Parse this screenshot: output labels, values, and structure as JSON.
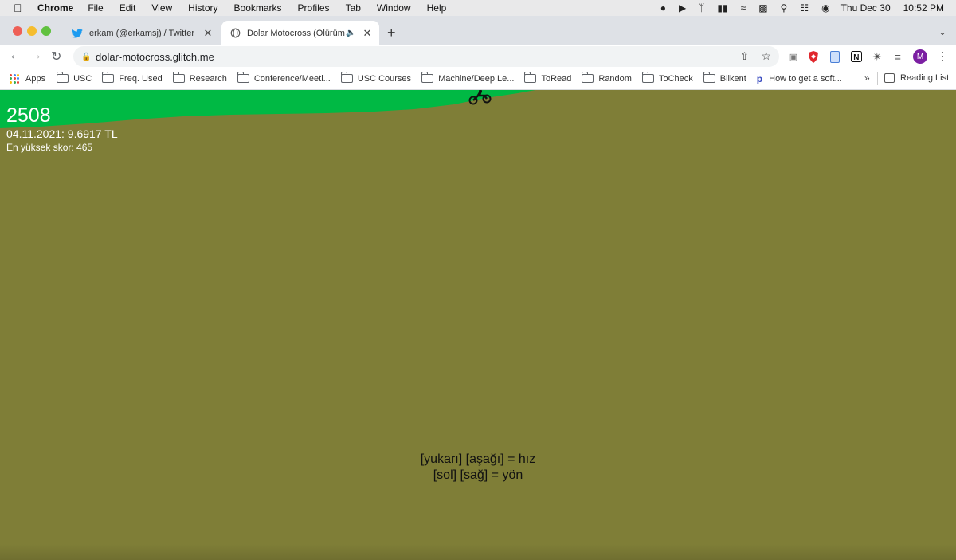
{
  "menubar": {
    "app": "Chrome",
    "items": [
      "File",
      "Edit",
      "View",
      "History",
      "Bookmarks",
      "Profiles",
      "Tab",
      "Window",
      "Help"
    ],
    "date": "Thu Dec 30",
    "time": "10:52 PM"
  },
  "tabs": [
    {
      "title": "erkam (@erkamsj) / Twitter",
      "icon": "twitter-icon"
    },
    {
      "title": "Dolar Motocross (Ölürüm T",
      "icon": "globe-icon"
    }
  ],
  "toolbar": {
    "url": "dolar-motocross.glitch.me",
    "avatar_letter": "M"
  },
  "bookmarks": {
    "apps_label": "Apps",
    "items": [
      "USC",
      "Freq. Used",
      "Research",
      "Conference/Meeti...",
      "USC Courses",
      "Machine/Deep Le...",
      "ToRead",
      "Random",
      "ToCheck",
      "Bilkent",
      "How to get a soft..."
    ],
    "more": "»",
    "reading_list": "Reading List"
  },
  "game": {
    "score": "2508",
    "rate": "04.11.2021: 9.6917 TL",
    "highscore": "En yüksek skor: 465",
    "controls_line1": "[yukarı] [aşağı] = hız",
    "controls_line2": "[sol] [sağ] = yön"
  },
  "colors": {
    "sky_ground": "#7f7e37",
    "grass": "#00b944",
    "accent_avatar": "#7b1fa2"
  }
}
